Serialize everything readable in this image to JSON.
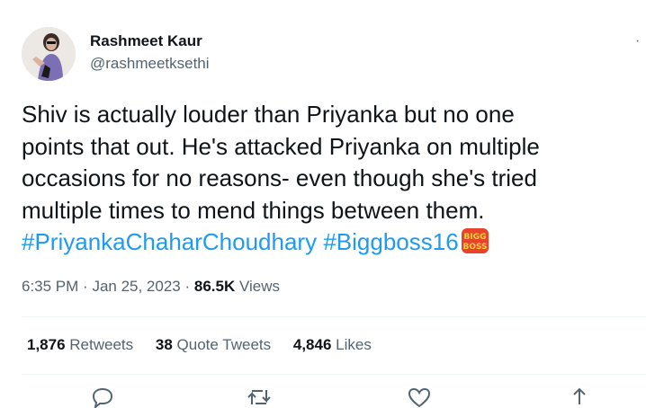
{
  "author": {
    "name": "Rashmeet Kaur",
    "handle": "@rashmeetksethi"
  },
  "tweet": {
    "lines": [
      "Shiv is actually louder than Priyanka but no one",
      "points that out. He's attacked Priyanka on multiple",
      "occasions for no reasons- even though she's tried",
      "multiple times to mend things between them."
    ],
    "hashtags": [
      "#PriyankaChaharChoudhary",
      "#Biggboss16"
    ],
    "emoji_icon": "bigg-boss-logo",
    "emoji_text": "BIGG BOSS"
  },
  "meta": {
    "time": "6:35 PM",
    "date": "Jan 25, 2023",
    "views_count": "86.5K",
    "views_label": "Views"
  },
  "stats": {
    "retweets_count": "1,876",
    "retweets_label": "Retweets",
    "quotes_count": "38",
    "quotes_label": "Quote Tweets",
    "likes_count": "4,846",
    "likes_label": "Likes"
  },
  "actions": [
    "reply-icon",
    "retweet-icon",
    "like-icon",
    "share-icon"
  ],
  "colors": {
    "link": "#1d9bf0",
    "secondary_text": "#536471",
    "primary_text": "#0f1419",
    "divider": "#eff3f4"
  }
}
